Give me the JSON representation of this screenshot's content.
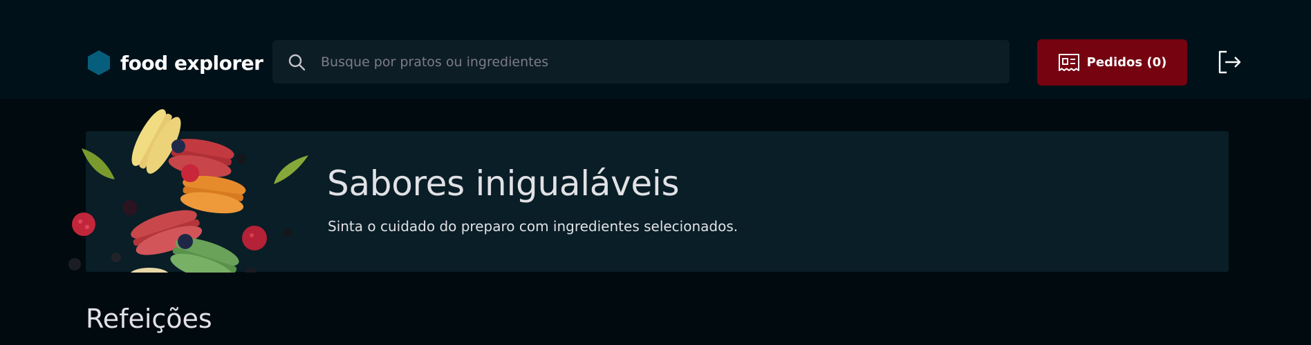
{
  "header": {
    "logo": {
      "text": "food explorer",
      "icon": "hexagon-icon",
      "color": "#065e7c"
    },
    "search": {
      "placeholder": "Busque por pratos ou ingredientes",
      "value": "",
      "icon": "search-icon"
    },
    "orders_button": {
      "label": "Pedidos (0)",
      "icon": "receipt-icon",
      "color": "#750310"
    },
    "signout_icon": "sign-out-icon"
  },
  "banner": {
    "title": "Sabores inigualáveis",
    "subtitle": "Sinta o cuidado do preparo com ingredientes selecionados."
  },
  "section": {
    "title": "Refeições"
  },
  "colors": {
    "background": "#000a0f",
    "header_background": "#00111a",
    "search_background": "#0d1d25",
    "banner_background": "#091e26",
    "text_light": "#e1e1e6"
  }
}
